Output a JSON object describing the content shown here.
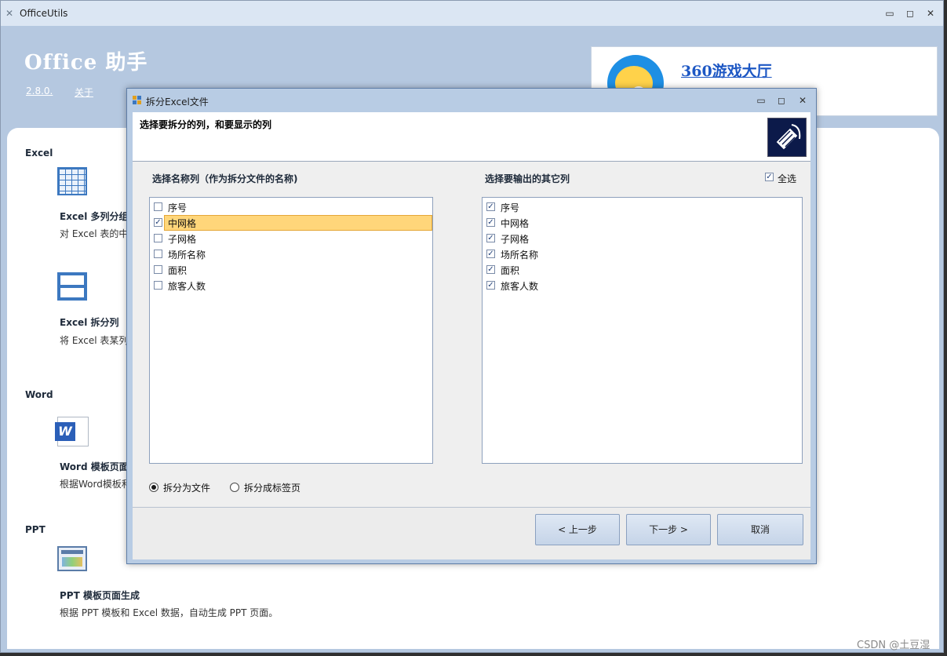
{
  "window": {
    "title": "OfficeUtils",
    "min": "▭",
    "max": "◻",
    "close": "✕"
  },
  "header": {
    "app_title": "Office 助手",
    "version": "2.8.0.",
    "about": "关于"
  },
  "ad": {
    "link_text": "360游戏大厅"
  },
  "sections": {
    "excel": "Excel",
    "word": "Word",
    "ppt": "PPT"
  },
  "tools": [
    {
      "title": "Excel 多列分组",
      "desc": "对 Excel 表的中"
    },
    {
      "title": "Excel 拆分列",
      "desc": "将 Excel 表某列"
    },
    {
      "title": "Word 模板页面",
      "desc": "根据Word模板和"
    },
    {
      "title": "PPT 模板页面生成",
      "desc": "根据 PPT 模板和 Excel 数据，自动生成 PPT 页面。"
    }
  ],
  "watermark": "CSDN @土豆湿",
  "dialog": {
    "title": "拆分Excel文件",
    "header_text": "选择要拆分的列，和要显示的列",
    "left_label": "选择名称列（作为拆分文件的名称)",
    "right_label": "选择要输出的其它列",
    "check_all": "全选",
    "check_all_checked": true,
    "left_items": [
      {
        "label": "序号",
        "checked": false,
        "selected": false
      },
      {
        "label": "中网格",
        "checked": true,
        "selected": true
      },
      {
        "label": "子网格",
        "checked": false,
        "selected": false
      },
      {
        "label": "场所名称",
        "checked": false,
        "selected": false
      },
      {
        "label": "面积",
        "checked": false,
        "selected": false
      },
      {
        "label": "旅客人数",
        "checked": false,
        "selected": false
      }
    ],
    "right_items": [
      {
        "label": "序号",
        "checked": true
      },
      {
        "label": "中网格",
        "checked": true
      },
      {
        "label": "子网格",
        "checked": true
      },
      {
        "label": "场所名称",
        "checked": true
      },
      {
        "label": "面积",
        "checked": true
      },
      {
        "label": "旅客人数",
        "checked": true
      }
    ],
    "radio_file": "拆分为文件",
    "radio_sheet": "拆分成标签页",
    "radio_selected": "file",
    "buttons": {
      "prev": "< 上一步",
      "next": "下一步 >",
      "cancel": "取消"
    }
  }
}
